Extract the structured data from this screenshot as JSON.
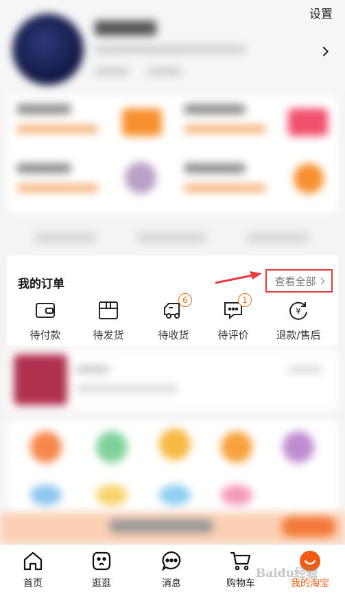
{
  "header": {
    "settings_label": "设置"
  },
  "orders": {
    "title": "我的订单",
    "view_all_label": "查看全部",
    "items": [
      {
        "label": "待付款",
        "icon": "wallet-icon",
        "badge": ""
      },
      {
        "label": "待发货",
        "icon": "box-icon",
        "badge": ""
      },
      {
        "label": "待收货",
        "icon": "truck-icon",
        "badge": "6"
      },
      {
        "label": "待评价",
        "icon": "comment-icon",
        "badge": "1"
      },
      {
        "label": "退款/售后",
        "icon": "refund-icon",
        "badge": ""
      }
    ]
  },
  "tabbar": {
    "items": [
      {
        "label": "首页",
        "icon": "home-icon"
      },
      {
        "label": "逛逛",
        "icon": "stroll-icon"
      },
      {
        "label": "消息",
        "icon": "message-icon"
      },
      {
        "label": "购物车",
        "icon": "cart-icon"
      },
      {
        "label": "我的淘宝",
        "icon": "my-taobao-icon"
      }
    ]
  },
  "colors": {
    "accent": "#f05a14",
    "highlight_border": "#e23a3a",
    "annotation_arrow": "#e83b3b"
  },
  "watermark": "Baidu经验"
}
